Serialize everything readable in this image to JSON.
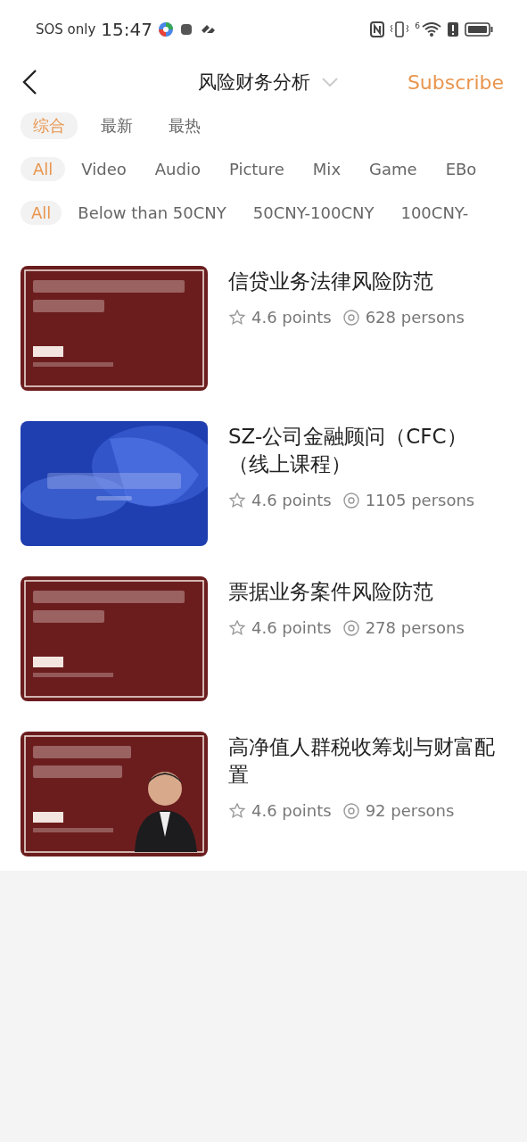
{
  "status_bar": {
    "carrier": "SOS only",
    "time": "15:47",
    "wifi_label": "6"
  },
  "header": {
    "title": "风险财务分析",
    "action": "Subscribe"
  },
  "sort_tabs": [
    {
      "label": "综合",
      "selected": true
    },
    {
      "label": "最新",
      "selected": false
    },
    {
      "label": "最热",
      "selected": false
    }
  ],
  "type_filters": [
    {
      "label": "All",
      "selected": true
    },
    {
      "label": "Video",
      "selected": false
    },
    {
      "label": "Audio",
      "selected": false
    },
    {
      "label": "Picture",
      "selected": false
    },
    {
      "label": "Mix",
      "selected": false
    },
    {
      "label": "Game",
      "selected": false
    },
    {
      "label": "EBo",
      "selected": false
    }
  ],
  "price_filters": [
    {
      "label": "All",
      "selected": true
    },
    {
      "label": "Below than 50CNY",
      "selected": false
    },
    {
      "label": "50CNY-100CNY",
      "selected": false
    },
    {
      "label": "100CNY-",
      "selected": false
    }
  ],
  "courses": [
    {
      "title": "信贷业务法律风险防范",
      "rating": "4.6 points",
      "views": "628 persons",
      "kind": "maroon"
    },
    {
      "title": "SZ-公司金融顾问（CFC）（线上课程）",
      "rating": "4.6 points",
      "views": "1105 persons",
      "kind": "blue"
    },
    {
      "title": "票据业务案件风险防范",
      "rating": "4.6 points",
      "views": "278 persons",
      "kind": "maroon"
    },
    {
      "title": "高净值人群税收筹划与财富配置",
      "rating": "4.6 points",
      "views": "92 persons",
      "kind": "portrait"
    }
  ]
}
